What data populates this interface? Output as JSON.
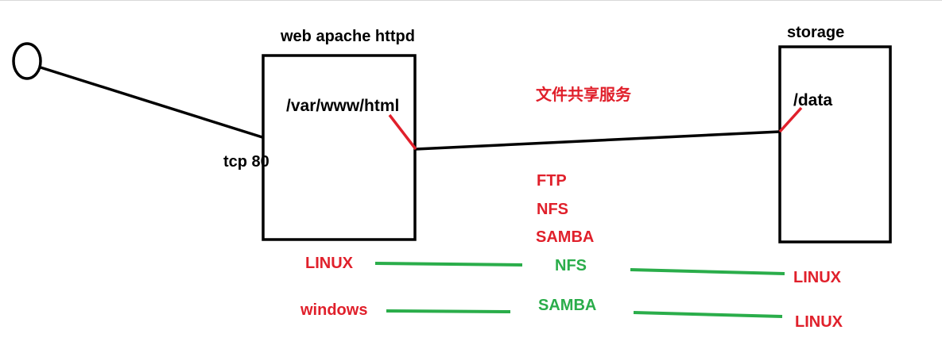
{
  "colors": {
    "ink": "#000000",
    "red": "#e0202b",
    "green": "#2aad4a"
  },
  "client": {
    "icon": "client-circle-icon",
    "port_label": "tcp 80"
  },
  "web_server": {
    "title": "web apache httpd",
    "path": "/var/www/html"
  },
  "storage": {
    "title": "storage",
    "path": "/data"
  },
  "file_sharing": {
    "heading": "文件共享服务",
    "protocols": [
      "FTP",
      "NFS",
      "SAMBA"
    ]
  },
  "mappings": [
    {
      "from": "LINUX",
      "via": "NFS",
      "to": "LINUX"
    },
    {
      "from": "windows",
      "via": "SAMBA",
      "to": "LINUX"
    }
  ]
}
